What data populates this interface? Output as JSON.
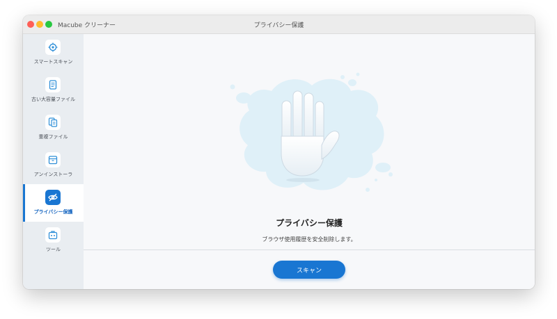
{
  "window": {
    "app_title": "Macube クリーナー",
    "title": "プライバシー保護"
  },
  "sidebar": {
    "items": [
      {
        "label": "スマートスキャン",
        "icon": "target-icon",
        "active": false
      },
      {
        "label": "古い大容量ファイル",
        "icon": "document-icon",
        "active": false
      },
      {
        "label": "重複ファイル",
        "icon": "duplicate-files-icon",
        "active": false
      },
      {
        "label": "アンインストーラ",
        "icon": "box-icon",
        "active": false
      },
      {
        "label": "プライバシー保護",
        "icon": "eye-slash-icon",
        "active": true
      },
      {
        "label": "ツール",
        "icon": "toolbox-icon",
        "active": false
      }
    ]
  },
  "main": {
    "hero_icon": "raised-hand-icon",
    "heading": "プライバシー保護",
    "description": "ブラウザ使用履歴を安全削除します。",
    "scan_button_label": "スキャン"
  },
  "colors": {
    "accent": "#1976d2",
    "sidebar_bg": "#e9edf1",
    "splash": "#dff0f8"
  }
}
